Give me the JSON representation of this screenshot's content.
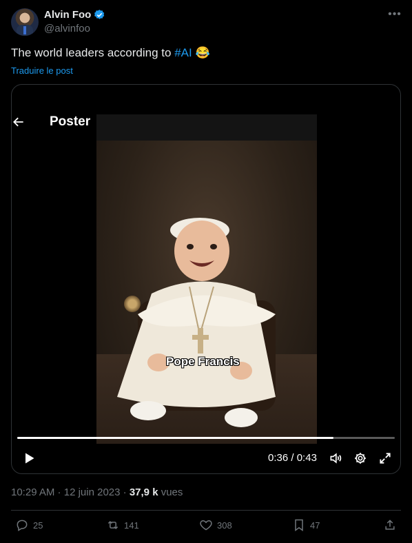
{
  "author": {
    "name": "Alvin Foo",
    "handle": "@alvinfoo",
    "verified": true
  },
  "tweet": {
    "text": "The world leaders according to ",
    "hashtag": "#AI",
    "emoji": "😂",
    "translate_label": "Traduire le post"
  },
  "video": {
    "header_title": "Poster",
    "caption": "Pope Francis",
    "current_time": "0:36",
    "time_separator": " / ",
    "duration": "0:43",
    "progress_fraction": 0.837
  },
  "meta": {
    "time": "10:29 AM",
    "date": "12 juin 2023",
    "views_count": "37,9 k",
    "views_label": "vues"
  },
  "actions": {
    "replies": "25",
    "reposts": "141",
    "likes": "308",
    "bookmarks": "47"
  },
  "colors": {
    "accent": "#1d9bf0",
    "background": "#000000",
    "muted": "#71767b"
  }
}
